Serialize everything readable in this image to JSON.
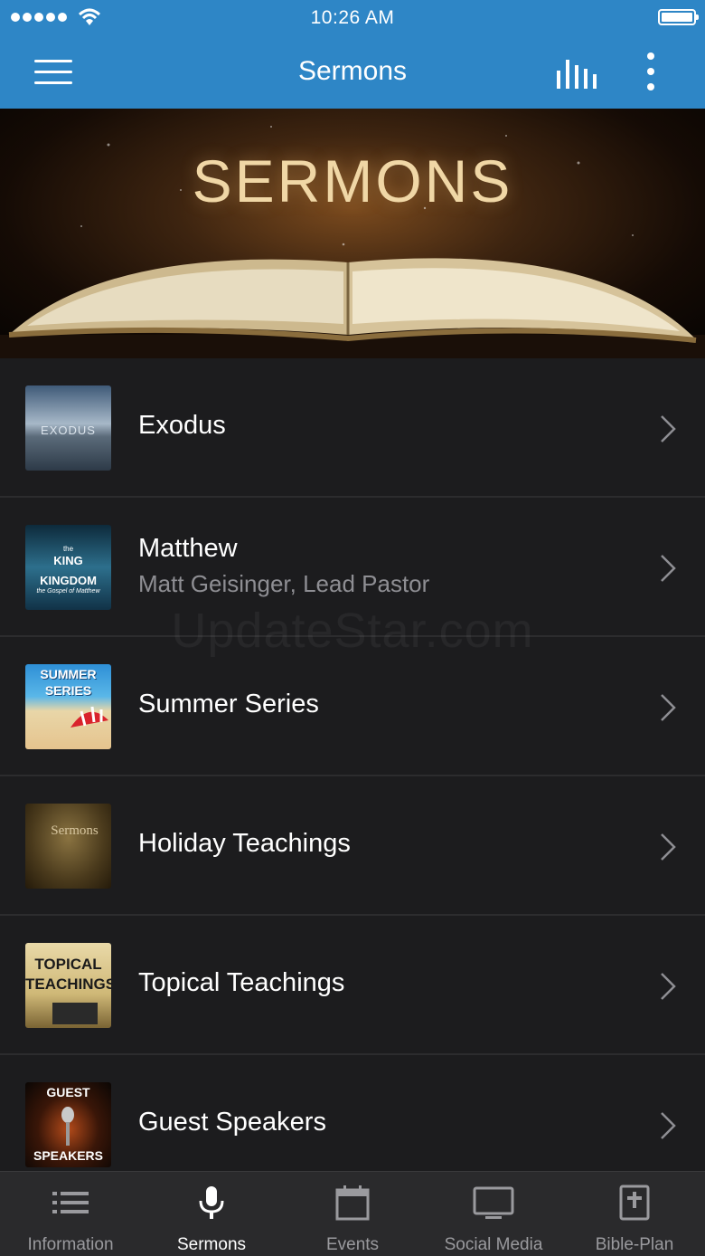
{
  "status_bar": {
    "time": "10:26 AM"
  },
  "header": {
    "title": "Sermons"
  },
  "banner": {
    "title": "SERMONS"
  },
  "list": [
    {
      "title": "Exodus",
      "thumb_text": "EXODUS"
    },
    {
      "title": "Matthew",
      "subtitle": "Matt Geisinger, Lead Pastor",
      "thumb_line1": "the",
      "thumb_line2": "KING",
      "thumb_line3": "KINGDOM",
      "thumb_line4": "the Gospel of Matthew"
    },
    {
      "title": "Summer Series",
      "thumb_line1": "SUMMER",
      "thumb_line2": "SERIES"
    },
    {
      "title": "Holiday Teachings",
      "thumb_text": "Sermons"
    },
    {
      "title": "Topical Teachings",
      "thumb_line1": "TOPICAL",
      "thumb_line2": "TEACHINGS"
    },
    {
      "title": "Guest Speakers",
      "thumb_line1": "GUEST",
      "thumb_line2": "SPEAKERS"
    }
  ],
  "watermark": "UpdateStar.com",
  "tabs": [
    {
      "label": "Information",
      "icon": "list-icon"
    },
    {
      "label": "Sermons",
      "icon": "microphone-icon",
      "active": true
    },
    {
      "label": "Events",
      "icon": "calendar-icon"
    },
    {
      "label": "Social Media",
      "icon": "monitor-icon"
    },
    {
      "label": "Bible-Plan",
      "icon": "bible-icon"
    }
  ],
  "colors": {
    "header_bg": "#2e86c6",
    "list_bg": "#1c1c1e",
    "tabbar_bg": "#2a2a2c",
    "subtitle": "#8e8e93"
  }
}
